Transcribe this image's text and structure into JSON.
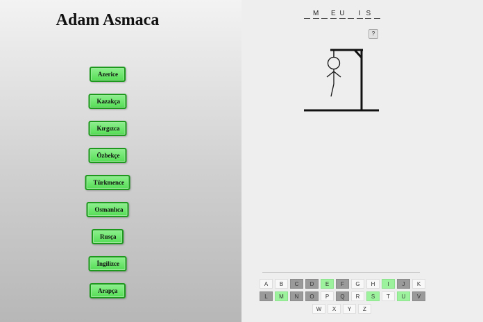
{
  "app_title": "Adam Asmaca",
  "languages": [
    "Azerice",
    "Kazakça",
    "Kırgızca",
    "Özbekçe",
    "Türkmence",
    "Osmanlıca",
    "Rusça",
    "İngilizce",
    "Arapça"
  ],
  "word_slots": [
    "",
    "M",
    "",
    "E",
    "U",
    "",
    "I",
    "S",
    ""
  ],
  "help_label": "?",
  "keyboard": {
    "rows": [
      [
        {
          "letter": "A",
          "state": "unused"
        },
        {
          "letter": "B",
          "state": "unused"
        },
        {
          "letter": "C",
          "state": "wrong"
        },
        {
          "letter": "D",
          "state": "wrong"
        },
        {
          "letter": "E",
          "state": "correct"
        },
        {
          "letter": "F",
          "state": "wrong"
        },
        {
          "letter": "G",
          "state": "unused"
        },
        {
          "letter": "H",
          "state": "unused"
        },
        {
          "letter": "I",
          "state": "correct"
        },
        {
          "letter": "J",
          "state": "wrong"
        },
        {
          "letter": "K",
          "state": "unused"
        }
      ],
      [
        {
          "letter": "L",
          "state": "wrong"
        },
        {
          "letter": "M",
          "state": "correct"
        },
        {
          "letter": "N",
          "state": "wrong"
        },
        {
          "letter": "O",
          "state": "wrong"
        },
        {
          "letter": "P",
          "state": "unused"
        },
        {
          "letter": "Q",
          "state": "wrong"
        },
        {
          "letter": "R",
          "state": "unused"
        },
        {
          "letter": "S",
          "state": "correct"
        },
        {
          "letter": "T",
          "state": "unused"
        },
        {
          "letter": "U",
          "state": "correct"
        },
        {
          "letter": "V",
          "state": "wrong"
        }
      ],
      [
        {
          "letter": "W",
          "state": "unused"
        },
        {
          "letter": "X",
          "state": "unused"
        },
        {
          "letter": "Y",
          "state": "unused"
        },
        {
          "letter": "Z",
          "state": "unused"
        }
      ]
    ]
  },
  "colors": {
    "button_green": "#55dd55",
    "correct_key": "#9df39d",
    "wrong_key": "#9a9a9a"
  }
}
